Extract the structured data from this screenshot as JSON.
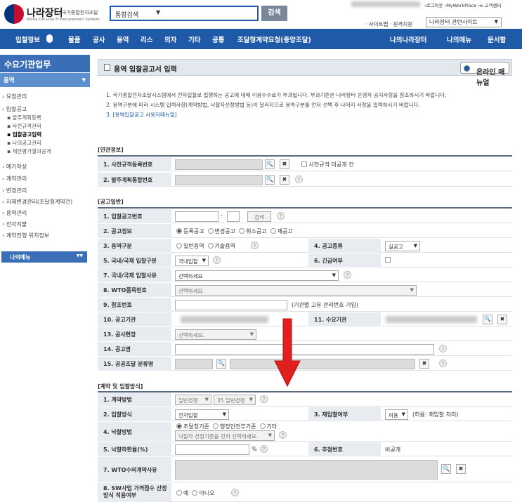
{
  "header": {
    "logo_name": "나라장터",
    "logo_sub": "국가종합전자조달",
    "logo_en": "Korea ON-Line E-Procurement System",
    "search_category": "통합검색",
    "search_button": "검색",
    "top_links": "›로그아웃 ›MyWorkPlace ›e-고객센터",
    "sitemap_links": "· 사이트맵 · 원격지원",
    "related_site": "나라장터 관련사이트"
  },
  "nav": {
    "items": [
      "입찰정보",
      "물품",
      "공사",
      "용역",
      "리스",
      "외자",
      "기타",
      "공통",
      "조달청계약요청(중앙조달)"
    ],
    "right_items": [
      "나의나라장터",
      "나의메뉴",
      "문서함"
    ]
  },
  "sidebar": {
    "title": "수요기관업무",
    "section": "용역",
    "items": [
      {
        "label": "› 요청관리",
        "type": "item"
      },
      {
        "label": "› 입찰공고",
        "type": "item"
      },
      {
        "label": "▪ 발주계획등록",
        "type": "sub"
      },
      {
        "label": "▪ 사전규격관리",
        "type": "sub"
      },
      {
        "label": "▪ 입찰공고입력",
        "type": "sub",
        "active": true
      },
      {
        "label": "▪ 나의공고관리",
        "type": "sub"
      },
      {
        "label": "▪ 제안평가결과공개",
        "type": "sub"
      },
      {
        "label": "› 예가작성",
        "type": "item"
      },
      {
        "label": "› 계약관리",
        "type": "item"
      },
      {
        "label": "› 변경관리",
        "type": "item"
      },
      {
        "label": "› 자체변경관리(조달청계약건)",
        "type": "item"
      },
      {
        "label": "› 용역관리",
        "type": "item"
      },
      {
        "label": "› 전자지불",
        "type": "item"
      },
      {
        "label": "› 계약진행 위치정보",
        "type": "item"
      }
    ],
    "my_menu": "나의메뉴"
  },
  "page": {
    "title": "용역 입찰공고서 입력",
    "manual_button": "온라인 매뉴얼",
    "notes": [
      "1. 국가종합전자조달시스템에서 전자입찰로 집행하는 공고에 대해 이용수수료가 부과됩니다. 부과기준은 나라장터 운영자 공지사항을 참조하시기 바랍니다.",
      "2. 용역구분에 따라 시스템 입력사항(계약방법, 낙찰자선정방법 등)이 달라지므로 용역구분를 먼저 선택 후 나머지 사항을 입력하시기 바랍니다.",
      "3. [용역입찰공고 사용자매뉴얼]"
    ]
  },
  "sections": {
    "related": {
      "title": "[연관정보]",
      "rows": {
        "r1_label": "1. 사전규격등록번호",
        "r1_check": "사전규격 미공개 건",
        "r2_label": "2. 발주계획통합번호"
      }
    },
    "general": {
      "title": "[공고일반]",
      "bid_no_label": "1. 입찰공고번호",
      "bid_no_sep": "-",
      "search_btn": "검색",
      "notice_info_label": "2. 공고정보",
      "notice_info_options": [
        "등록공고",
        "변경공고",
        "취소공고",
        "재공고"
      ],
      "service_type_label": "3. 용역구분",
      "service_type_options": [
        "일반용역",
        "기술용역"
      ],
      "notice_kind_label": "4. 공고종류",
      "notice_kind_value": "실공고",
      "intl_label": "5. 국내/국제 입찰구분",
      "intl_value": "국내입찰",
      "urgent_label": "6. 긴급여부",
      "intl_reason_label": "7. 국내/국제 입찰사유",
      "intl_reason_value": "선택하세요",
      "wto_label": "8. WTO품목번호",
      "wto_value": "선택하세요",
      "ref_label": "9. 참조번호",
      "ref_hint": "(기관별 고유 관리번호 기입)",
      "agency_label": "10. 공고기관",
      "demand_label": "11. 수요기관",
      "site_label": "13. 공사현장",
      "site_value": "선택하세요.",
      "name_label": "14. 공고명",
      "class_label": "15. 공공조달 분류명"
    },
    "contract": {
      "title": "[계약 및 입찰방식]",
      "method_label": "1. 계약방법",
      "method_value1": "일반경쟁",
      "method_value2": "35 일반경쟁",
      "bid_method_label": "2. 입찰방식",
      "bid_method_value": "전자입찰",
      "rebid_label": "3. 재입찰여부",
      "rebid_value": "허용",
      "rebid_hint": "(허용: 재입찰 처리)",
      "award_label": "4. 낙찰방법",
      "award_options": [
        "조달청기준",
        "행정안전부기준",
        "기타"
      ],
      "award_select": "낙찰자 선정기준을 먼저 선택하세요.",
      "rate_label": "5. 낙찰하한율(%)",
      "rate_unit": "%",
      "lottery_label": "6. 추첨번호",
      "lottery_value": "비공개",
      "wto_reason_label": "7. WTO수의계약사유",
      "sw_label": "8. SW사업 가격점수 산정방식 적용여부",
      "sw_options": [
        "예",
        "아니오"
      ]
    }
  },
  "colors": {
    "primary": "#1e5aa8",
    "arrow": "#e0201c",
    "label_bg": "#e8ebf0"
  }
}
